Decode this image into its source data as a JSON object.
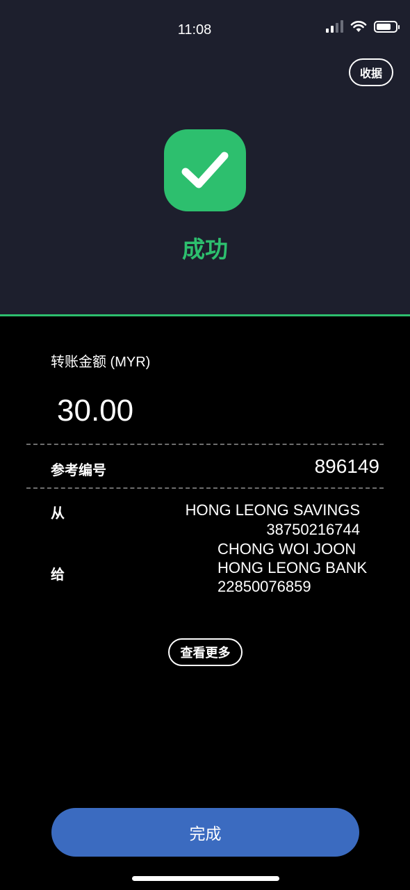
{
  "status_bar": {
    "time": "11:08",
    "battery_level": 0.76,
    "signal_bars_active": 2,
    "signal_bars_total": 4
  },
  "header": {
    "receipt_button": "收据",
    "status_label": "成功",
    "status_icon": "checkmark-icon"
  },
  "transfer": {
    "amount_label": "转账金额 (MYR)",
    "amount_value": "30.00",
    "reference_label": "参考编号",
    "reference_value": "896149",
    "from_label": "从",
    "from_account_name": "HONG LEONG SAVINGS",
    "from_account_number": "38750216744",
    "to_label": "给",
    "to_name": "CHONG WOI JOON",
    "to_bank": "HONG LEONG BANK",
    "to_account_number": "22850076859"
  },
  "actions": {
    "view_more": "查看更多",
    "done": "完成"
  },
  "colors": {
    "accent_green": "#2dbf6e",
    "header_background": "#1d1f2d",
    "primary_button": "#3b6bc0",
    "background": "#000000"
  }
}
